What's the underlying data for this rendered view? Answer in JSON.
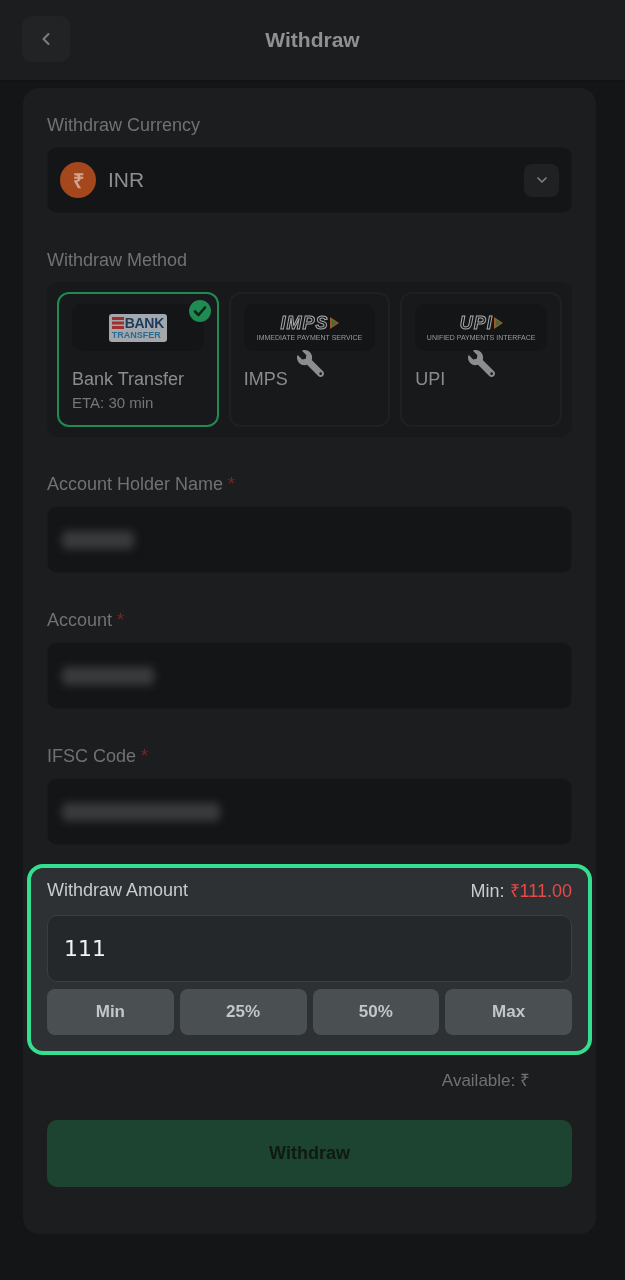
{
  "header": {
    "title": "Withdraw"
  },
  "currency": {
    "label": "Withdraw Currency",
    "symbol": "₹",
    "code": "INR"
  },
  "method": {
    "label": "Withdraw Method",
    "options": [
      {
        "kind": "bank",
        "logo": {
          "title": "BANK",
          "subtitle": "TRANSFER"
        },
        "name": "Bank Transfer",
        "eta": "ETA: 30 min",
        "selected": true,
        "maintenance": false
      },
      {
        "kind": "imps",
        "logo": {
          "title": "IMPS",
          "subtitle": "IMMEDIATE PAYMENT SERVICE"
        },
        "name": "IMPS",
        "selected": false,
        "maintenance": true
      },
      {
        "kind": "upi",
        "logo": {
          "title": "UPI",
          "subtitle": "UNIFIED PAYMENTS INTERFACE"
        },
        "name": "UPI",
        "selected": false,
        "maintenance": true
      }
    ]
  },
  "fields": [
    {
      "label": "Account Holder Name",
      "required_mark": "*",
      "value_blurred": true
    },
    {
      "label": "Account",
      "required_mark": "*",
      "value_blurred": true
    },
    {
      "label": "IFSC Code",
      "required_mark": "*",
      "value_blurred": true
    }
  ],
  "amount": {
    "label": "Withdraw Amount",
    "min_label": "Min:",
    "min_value": "₹111.00",
    "value": "111",
    "highlighted": true,
    "presets": [
      {
        "label": "Min"
      },
      {
        "label": "25%"
      },
      {
        "label": "50%"
      },
      {
        "label": "Max"
      }
    ]
  },
  "available": {
    "label": "Available: ₹"
  },
  "submit": {
    "label": "Withdraw"
  }
}
